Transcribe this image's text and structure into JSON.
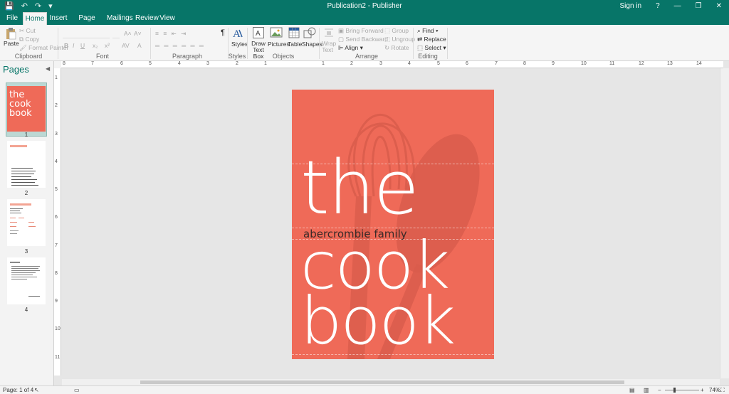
{
  "window": {
    "title": "Publication2 - Publisher",
    "sign_in": "Sign in",
    "help": "?",
    "minimize": "—",
    "restore": "❐",
    "close": "✕"
  },
  "qat": {
    "save": "💾",
    "undo": "↶",
    "redo": "↷",
    "customize": "▾"
  },
  "tabs": [
    "File",
    "Home",
    "Insert",
    "Page Design",
    "Mailings",
    "Review",
    "View"
  ],
  "active_tab": "Home",
  "ribbon": {
    "clipboard": {
      "label": "Clipboard",
      "paste": "Paste",
      "cut": "Cut",
      "copy": "Copy",
      "format_painter": "Format Painter"
    },
    "font": {
      "label": "Font",
      "bold": "B",
      "italic": "I",
      "underline": "U",
      "sub": "x₂",
      "super": "x²",
      "spacing": "AV",
      "clear": "A"
    },
    "paragraph": {
      "label": "Paragraph",
      "pilcrow": "¶"
    },
    "styles": {
      "label": "Styles",
      "styles": "Styles"
    },
    "objects": {
      "label": "Objects",
      "draw_text_box": "Draw Text Box",
      "pictures": "Pictures",
      "table": "Table",
      "shapes": "Shapes"
    },
    "arrange": {
      "label": "Arrange",
      "wrap_text": "Wrap Text",
      "bring_forward": "Bring Forward",
      "send_backward": "Send Backward",
      "align": "Align",
      "group": "Group",
      "ungroup": "Ungroup",
      "rotate": "Rotate"
    },
    "editing": {
      "label": "Editing",
      "find": "Find",
      "replace": "Replace",
      "select": "Select"
    }
  },
  "pages_pane": {
    "title": "Pages",
    "pages": [
      {
        "num": "1",
        "t1": "the",
        "t2": "cook",
        "t3": "book"
      },
      {
        "num": "2"
      },
      {
        "num": "3"
      },
      {
        "num": "4"
      }
    ]
  },
  "ruler": {
    "h_labels": [
      "8",
      "7",
      "6",
      "5",
      "4",
      "3",
      "2",
      "1",
      "",
      "1",
      "2",
      "3",
      "4",
      "5",
      "6",
      "7",
      "8",
      "9",
      "10",
      "11",
      "12",
      "13",
      "14"
    ],
    "v_labels": [
      "1",
      "2",
      "3",
      "4",
      "5",
      "6",
      "7",
      "8",
      "9",
      "10",
      "11"
    ]
  },
  "cover": {
    "word1": "the",
    "subtitle": "abercrombie family",
    "word2": "cook",
    "word3": "book",
    "colors": {
      "background": "#ef6a58",
      "text": "#ffffff",
      "subtitle": "#3a2a28"
    }
  },
  "status": {
    "page": "Page: 1 of 4",
    "zoom": "74%"
  }
}
